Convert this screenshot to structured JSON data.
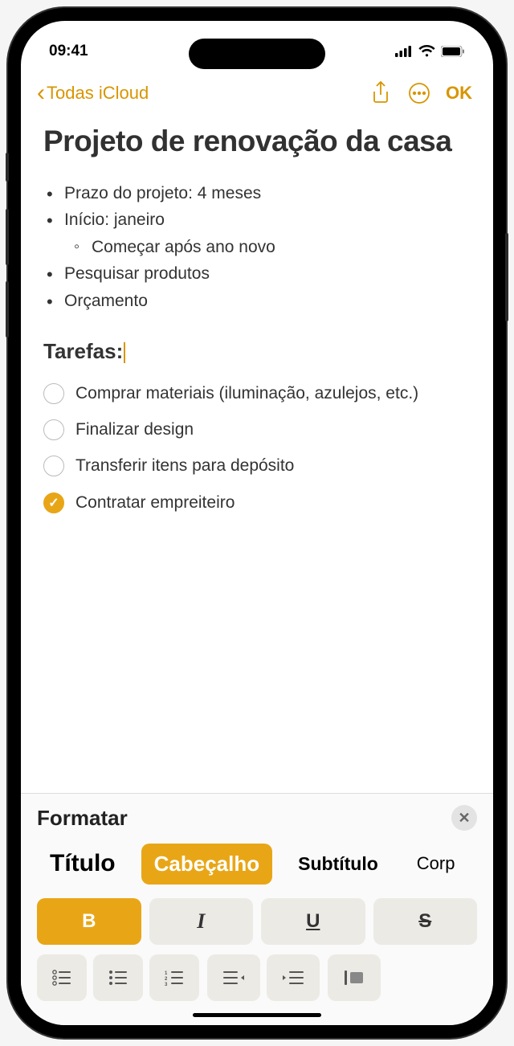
{
  "status": {
    "time": "09:41"
  },
  "nav": {
    "back_label": "Todas iCloud",
    "ok_label": "OK"
  },
  "note": {
    "title": "Projeto de renovação da casa",
    "bullets": [
      "Prazo do projeto: 4 meses",
      "Início: janeiro",
      "Começar após ano novo",
      "Pesquisar produtos",
      "Orçamento"
    ],
    "heading": "Tarefas:",
    "tasks": [
      {
        "text": "Comprar materiais (iluminação, azulejos, etc.)",
        "done": false
      },
      {
        "text": "Finalizar design",
        "done": false
      },
      {
        "text": "Transferir itens para depósito",
        "done": false
      },
      {
        "text": "Contratar empreiteiro",
        "done": true
      }
    ]
  },
  "format": {
    "title": "Formatar",
    "styles": {
      "titulo": "Título",
      "cabecalho": "Cabeçalho",
      "subtitulo": "Subtítulo",
      "corpo": "Corp"
    },
    "buttons": {
      "bold": "B",
      "italic": "I",
      "underline": "U",
      "strike": "S"
    }
  }
}
